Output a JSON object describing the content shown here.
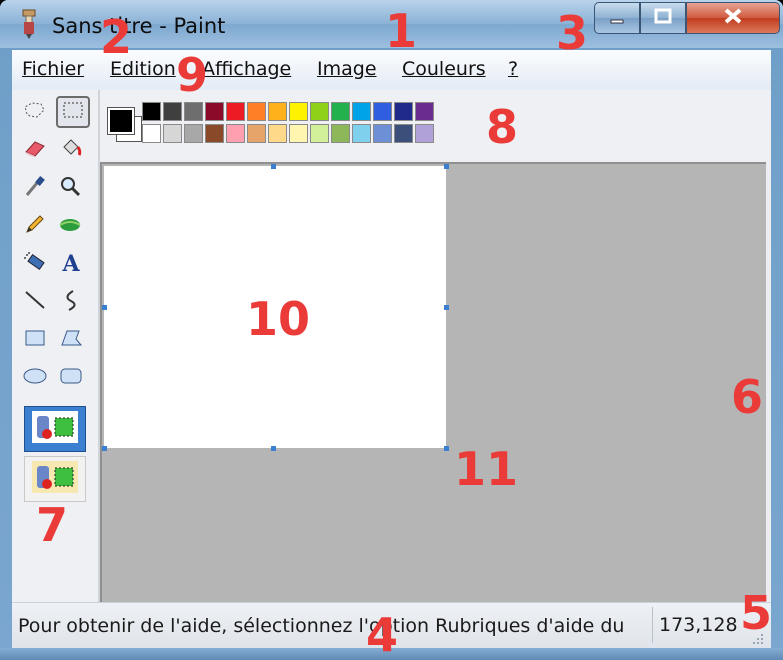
{
  "window": {
    "title": "Sans titre - Paint",
    "icon": "paint-app-icon"
  },
  "title_buttons": {
    "minimize": "minimize-icon",
    "maximize": "maximize-icon",
    "close": "close-icon"
  },
  "menu": {
    "items": [
      {
        "label": "Fichier"
      },
      {
        "label": "Edition"
      },
      {
        "label": "Affichage"
      },
      {
        "label": "Image"
      },
      {
        "label": "Couleurs"
      },
      {
        "label": "?"
      }
    ]
  },
  "tools": [
    {
      "name": "free-form-select-icon"
    },
    {
      "name": "rect-select-icon"
    },
    {
      "name": "eraser-icon"
    },
    {
      "name": "fill-bucket-icon"
    },
    {
      "name": "color-picker-icon"
    },
    {
      "name": "magnifier-icon"
    },
    {
      "name": "pencil-icon"
    },
    {
      "name": "brush-icon"
    },
    {
      "name": "airbrush-icon"
    },
    {
      "name": "text-tool-icon",
      "glyph": "A"
    },
    {
      "name": "line-icon"
    },
    {
      "name": "curve-icon"
    },
    {
      "name": "rectangle-icon"
    },
    {
      "name": "polygon-icon"
    },
    {
      "name": "ellipse-icon"
    },
    {
      "name": "rounded-rect-icon"
    }
  ],
  "palette": {
    "foreground": "#000000",
    "background": "#ffffff",
    "row1": [
      "#000000",
      "#3f3f3f",
      "#6e6e6e",
      "#8b0a2a",
      "#ed1c24",
      "#ff7f27",
      "#ffb11b",
      "#fff200",
      "#8fd118",
      "#22b14c",
      "#00a2e8",
      "#2f5fe0",
      "#1f2a8a",
      "#6a2c8e"
    ],
    "row2": [
      "#ffffff",
      "#d6d6d6",
      "#a8a8a8",
      "#8a4a2a",
      "#ff9fb0",
      "#e6a46b",
      "#ffd98a",
      "#fff4b0",
      "#d2ef9a",
      "#8db85a",
      "#7fd0ec",
      "#6c8fd6",
      "#3b4f7a",
      "#b0a2d8"
    ]
  },
  "status": {
    "help_text": "Pour obtenir de l'aide, sélectionnez l'option Rubriques d'aide du",
    "coords": "173,128"
  },
  "annotations": [
    "1",
    "2",
    "3",
    "4",
    "5",
    "6",
    "7",
    "8",
    "9",
    "10",
    "11"
  ],
  "colors": {
    "annotation": "#ea3b38",
    "canvas_bg": "#b5b5b5",
    "selection_handle": "#3a7fd0"
  }
}
